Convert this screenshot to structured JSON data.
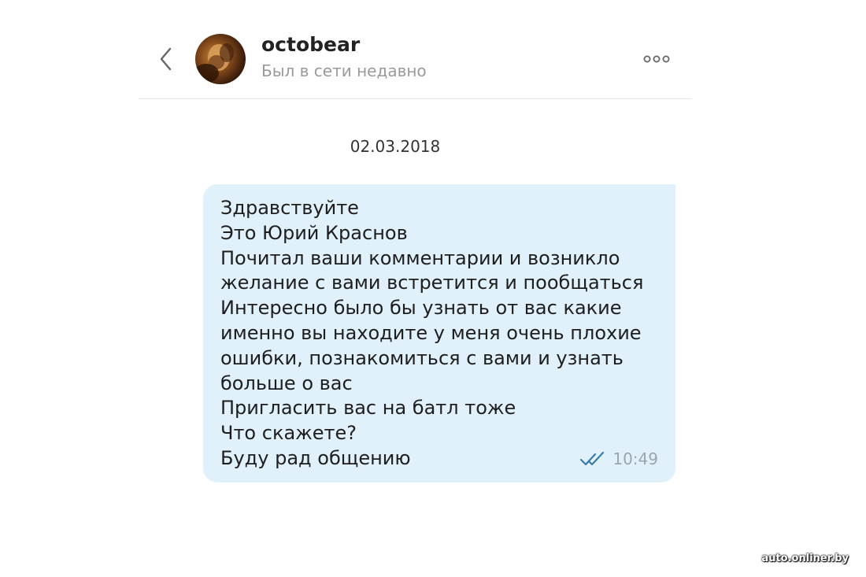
{
  "header": {
    "contact_name": "octobear",
    "contact_status": "Был в сети недавно",
    "back_icon": "chevron-left-icon",
    "more_icon": "more-horizontal-icon"
  },
  "date_separator": "02.03.2018",
  "message": {
    "lines": [
      "Здравствуйте",
      "Это Юрий Краснов",
      "Почитал ваши комментарии и возникло",
      "желание с вами встретится и пообщаться",
      "Интересно было бы узнать от вас какие",
      "именно вы находите у меня очень плохие",
      "ошибки, познакомиться с вами и узнать",
      "больше о вас",
      "Пригласить вас на батл тоже",
      "Что скажете?",
      "Буду рад общению"
    ],
    "time": "10:49",
    "status_icon": "double-check-icon",
    "bubble_color": "#e1f1fb",
    "check_color": "#3a7ca5"
  },
  "watermark": "auto.onliner.by"
}
